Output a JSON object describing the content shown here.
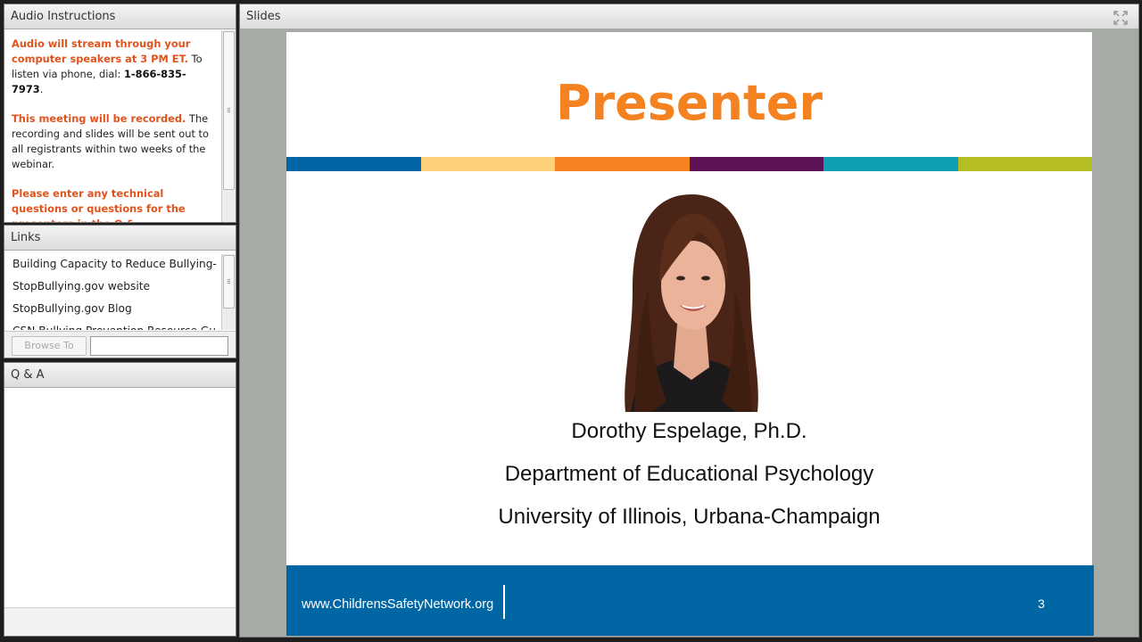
{
  "audio_pod": {
    "title": "Audio Instructions",
    "p1_highlight": "Audio will stream through your computer speakers at 3 PM ET.",
    "p1_text": " To listen via phone, dial: ",
    "p1_phone": "1-866-835-7973",
    "p1_end": ".",
    "p2_highlight": "This meeting will be recorded.",
    "p2_text": " The recording and slides will be sent out to all registrants within two weeks of the webinar.",
    "p3_highlight": "Please enter any technical questions or questions for the presenters in the Q &"
  },
  "links_pod": {
    "title": "Links",
    "items": [
      {
        "label": "Building Capacity to Reduce Bullying-"
      },
      {
        "label": "StopBullying.gov website"
      },
      {
        "label": "StopBullying.gov Blog"
      },
      {
        "label": "CSN Bullying Prevention Resource Gu"
      }
    ],
    "browse_label": "Browse To",
    "url_value": ""
  },
  "qa_pod": {
    "title": "Q & A"
  },
  "slides_pod": {
    "title": "Slides",
    "fullscreen_icon": "fullscreen-icon"
  },
  "slide": {
    "title": "Presenter",
    "stripe_colors": [
      "#0066a4",
      "#fdd07c",
      "#f58220",
      "#5c1457",
      "#0e9fb5",
      "#b4bd22"
    ],
    "presenter_name": "Dorothy Espelage, Ph.D.",
    "department": "Department of Educational Psychology",
    "university": "University of Illinois, Urbana-Champaign",
    "footer_url": "www.ChildrensSafetyNetwork.org",
    "page_number": "3",
    "footer_color": "#0066a4",
    "title_color": "#f58220"
  }
}
